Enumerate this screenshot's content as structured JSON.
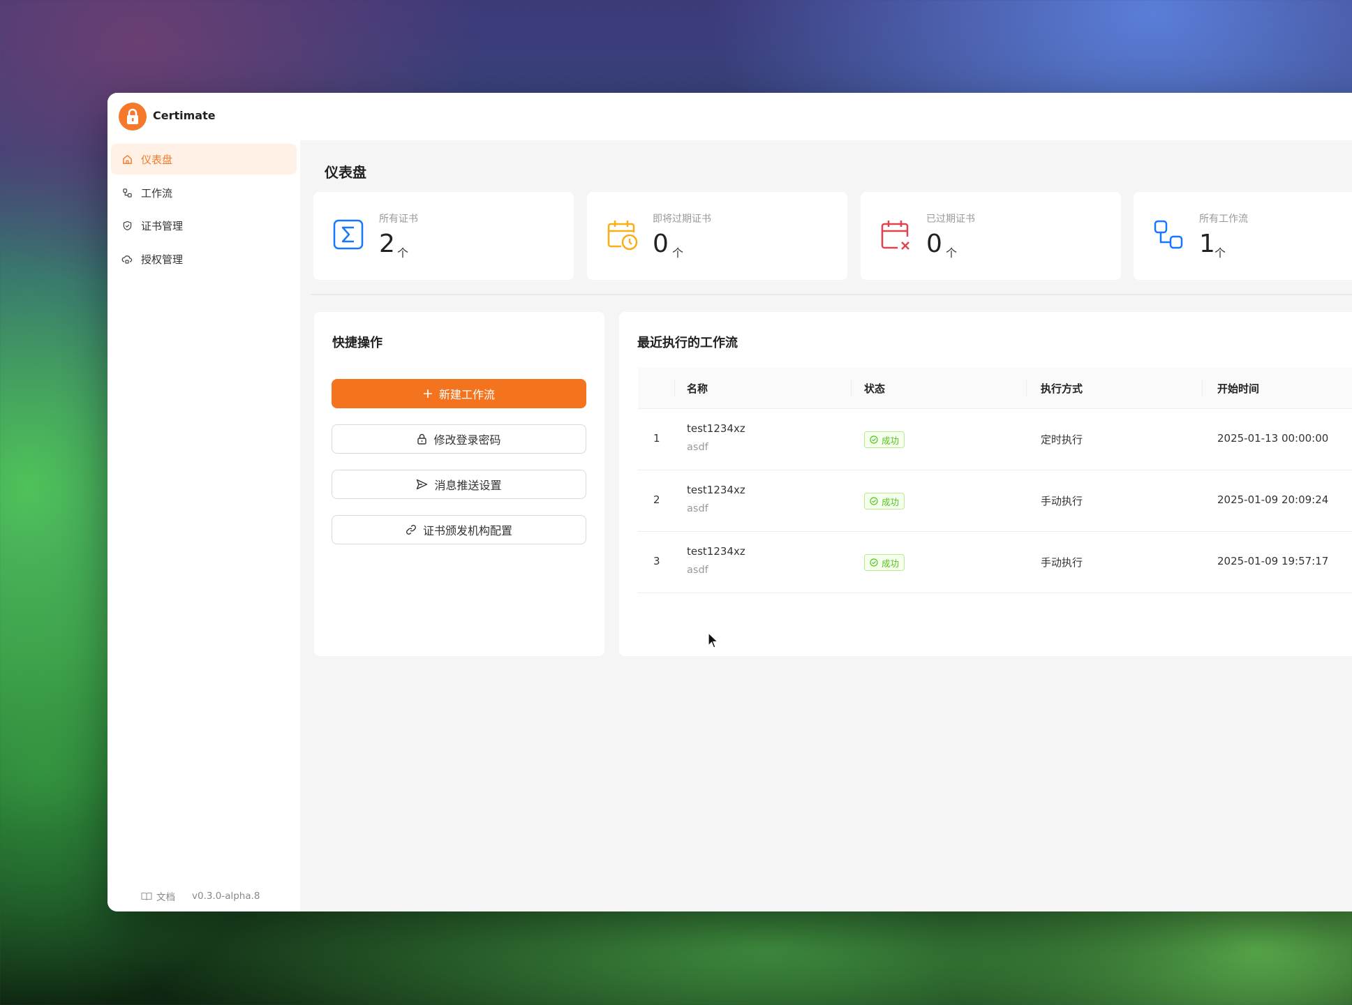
{
  "app": {
    "name": "Certimate"
  },
  "sidebar": {
    "items": [
      {
        "label": "仪表盘",
        "icon": "home-icon",
        "active": true
      },
      {
        "label": "工作流",
        "icon": "workflow-icon",
        "active": false
      },
      {
        "label": "证书管理",
        "icon": "shield-check-icon",
        "active": false
      },
      {
        "label": "授权管理",
        "icon": "cloud-lock-icon",
        "active": false
      }
    ],
    "footer": {
      "docs_label": "文档",
      "version": "v0.3.0-alpha.8"
    }
  },
  "main": {
    "title": "仪表盘",
    "stats": [
      {
        "label": "所有证书",
        "value": "2",
        "unit": "个",
        "icon": "sigma-icon",
        "color": "#1677ff"
      },
      {
        "label": "即将过期证书",
        "value": "0",
        "unit": "个",
        "icon": "calendar-clock-icon",
        "color": "#faad14"
      },
      {
        "label": "已过期证书",
        "value": "0",
        "unit": "个",
        "icon": "calendar-x-icon",
        "color": "#f5222d"
      },
      {
        "label": "所有工作流",
        "value": "1",
        "unit": "个",
        "icon": "workflow-icon",
        "color": "#1677ff"
      }
    ],
    "quick_actions": {
      "title": "快捷操作",
      "buttons": [
        {
          "label": "新建工作流",
          "icon": "plus-icon",
          "primary": true
        },
        {
          "label": "修改登录密码",
          "icon": "lock-icon",
          "primary": false
        },
        {
          "label": "消息推送设置",
          "icon": "send-icon",
          "primary": false
        },
        {
          "label": "证书颁发机构配置",
          "icon": "link-icon",
          "primary": false
        }
      ]
    },
    "recent_runs": {
      "title": "最近执行的工作流",
      "columns": [
        "名称",
        "状态",
        "执行方式",
        "开始时间"
      ],
      "rows": [
        {
          "index": "1",
          "name": "test1234xz",
          "desc": "asdf",
          "status": "成功",
          "trigger": "定时执行",
          "start": "2025-01-13 00:00:00"
        },
        {
          "index": "2",
          "name": "test1234xz",
          "desc": "asdf",
          "status": "成功",
          "trigger": "手动执行",
          "start": "2025-01-09 20:09:24"
        },
        {
          "index": "3",
          "name": "test1234xz",
          "desc": "asdf",
          "status": "成功",
          "trigger": "手动执行",
          "start": "2025-01-09 19:57:17"
        }
      ]
    }
  },
  "colors": {
    "accent": "#f4792a",
    "success": "#52c41a"
  }
}
